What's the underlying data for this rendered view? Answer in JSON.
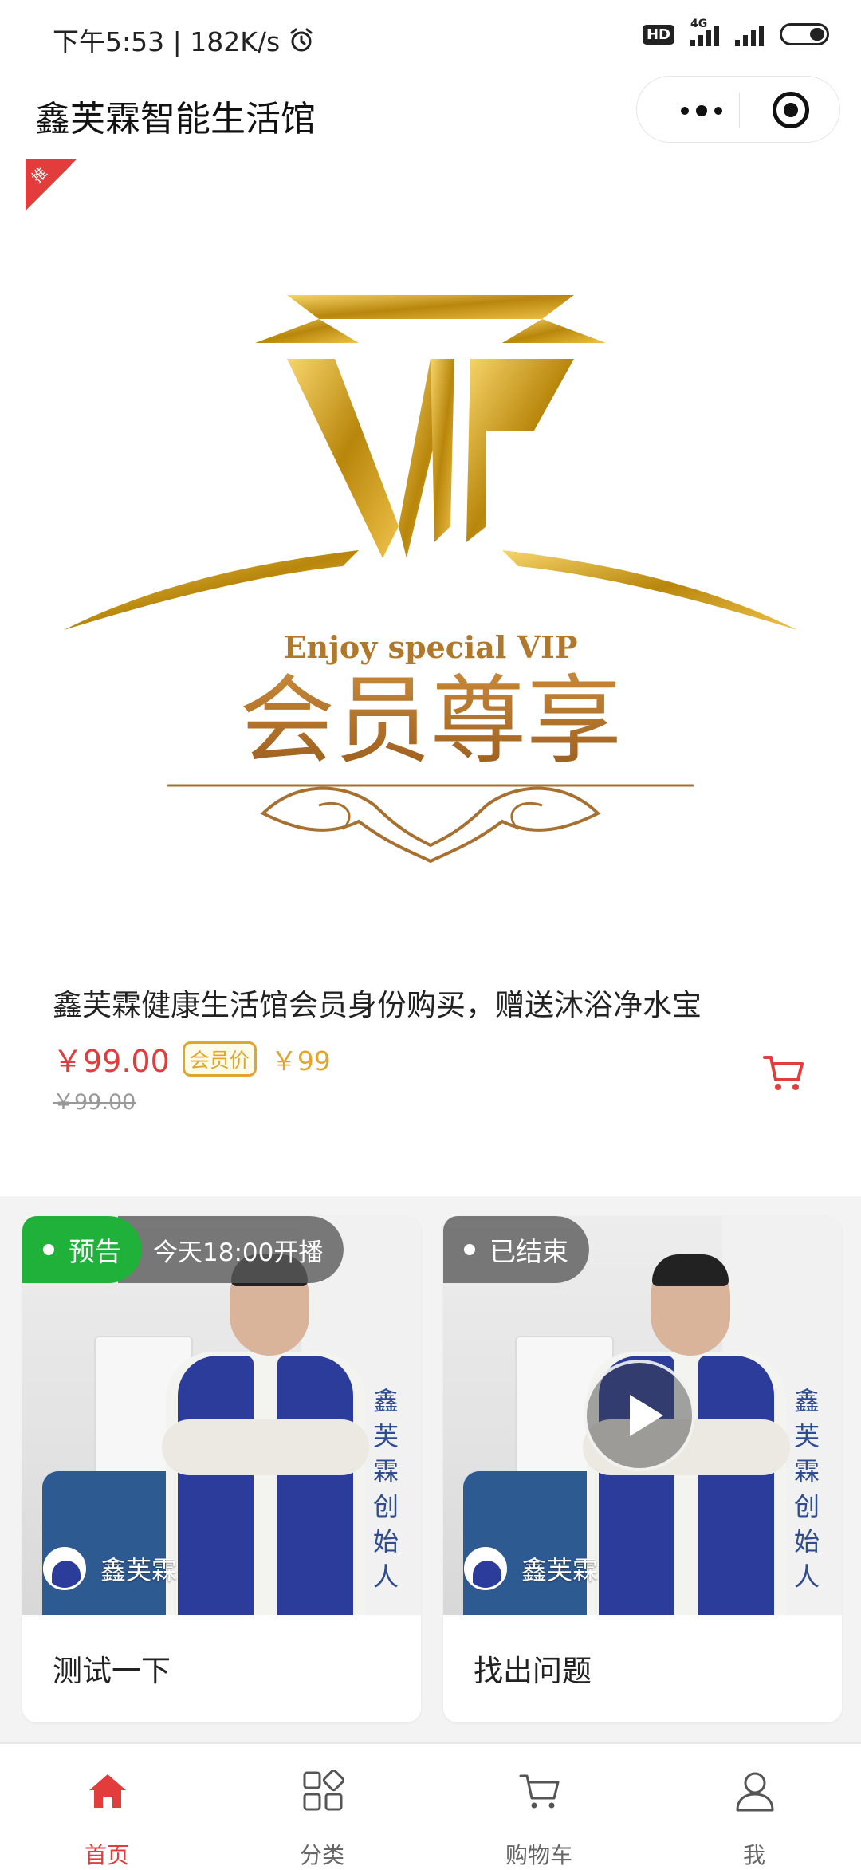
{
  "status_bar": {
    "time_speed": "下午5:53 | 182K/s",
    "hd": "HD",
    "network": "4G"
  },
  "nav": {
    "title": "鑫芙霖智能生活馆"
  },
  "product": {
    "corner_badge": "推",
    "image_lettering": [
      "VIP",
      "Enjoy special VIP",
      "会员尊享"
    ],
    "title": "鑫芙霖健康生活馆会员身份购买，赠送沐浴净水宝",
    "price": "￥99.00",
    "member_badge": "会员价",
    "member_price": "￥99",
    "original_price": "￥99.00"
  },
  "live": [
    {
      "status": "预告",
      "time": "今天18:00开播",
      "host": "鑫芙霖",
      "title": "测试一下",
      "status_color": "#1fb13a"
    },
    {
      "status": "已结束",
      "host": "鑫芙霖",
      "title": "找出问题",
      "status_color": "#5a5a5a"
    }
  ],
  "tabs": [
    {
      "label": "首页",
      "icon": "home-icon",
      "active": true
    },
    {
      "label": "分类",
      "icon": "category-icon",
      "active": false
    },
    {
      "label": "购物车",
      "icon": "cart-icon",
      "active": false
    },
    {
      "label": "我",
      "icon": "user-icon",
      "active": false
    }
  ],
  "colors": {
    "accent": "#e23c3c",
    "gold": "#e0a530",
    "live_green": "#1fb13a"
  }
}
